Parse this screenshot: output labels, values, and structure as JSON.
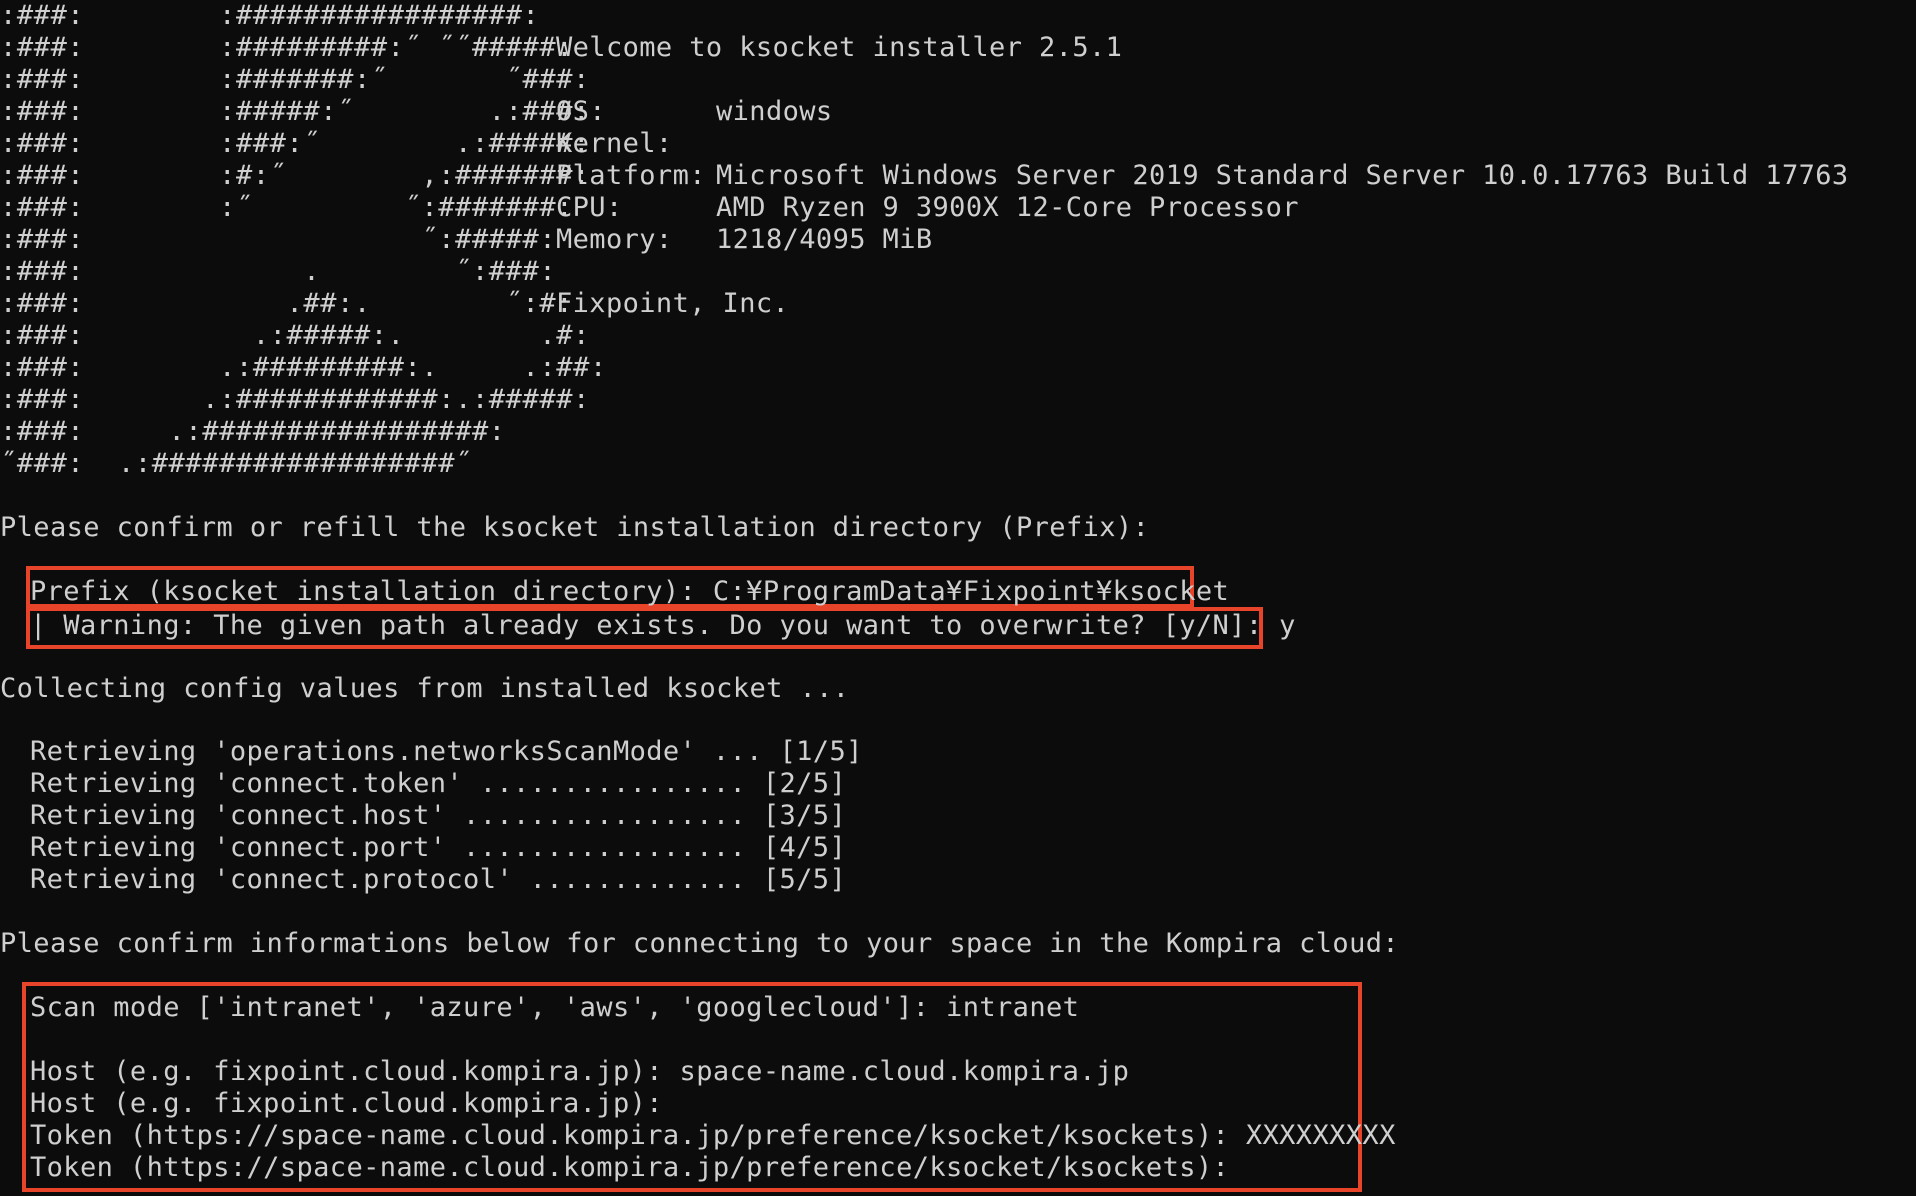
{
  "art": [
    ":###:        :#################:",
    ":###:        :#########:˝ ˝˝#####:",
    ":###:        :#######:˝       ˝###:",
    ":###:        :#####:˝        .:###:",
    ":###:        :###:˝        .:#####:",
    ":###:        :#:˝        ,:#######:",
    ":###:        :˝         ˝:#######:",
    ":###:                    ˝:#####:",
    ":###:             .        ˝:###:",
    ":###:            .##:.        ˝:#:",
    ":###:          .:#####:.        .#:",
    ":###:        .:#########:.     .:##:",
    ":###:       .:############:.:#####:",
    ":###:     .:#################:",
    "˝###:  .:##################˝"
  ],
  "info": {
    "welcome": "Welcome to ksocket installer 2.5.1",
    "os_label": "OS:",
    "os_value": "windows",
    "kernel_label": "Kernel:",
    "kernel_value": "",
    "platform_label": "Platform:",
    "platform_value": "Microsoft Windows Server 2019 Standard Server 10.0.17763 Build 17763",
    "cpu_label": "CPU:",
    "cpu_value": "AMD Ryzen 9 3900X 12-Core Processor",
    "memory_label": "Memory:",
    "memory_value": "1218/4095 MiB",
    "company": "Fixpoint, Inc."
  },
  "prefix_prompt": "Please confirm or refill the ksocket installation directory (Prefix):",
  "prefix_line": "Prefix (ksocket installation directory): C:¥ProgramData¥Fixpoint¥ksocket",
  "warning_line": "| Warning: The given path already exists. Do you want to overwrite? [y/N]: y",
  "collecting": "Collecting config values from installed ksocket ...",
  "retrieving": [
    "Retrieving 'operations.networksScanMode' ... [1/5]",
    "Retrieving 'connect.token' ................ [2/5]",
    "Retrieving 'connect.host' ................. [3/5]",
    "Retrieving 'connect.port' ................. [4/5]",
    "Retrieving 'connect.protocol' ............. [5/5]"
  ],
  "confirm_prompt": "Please confirm informations below for connecting to your space in the Kompira cloud:",
  "scan_mode": "Scan mode ['intranet', 'azure', 'aws', 'googlecloud']: intranet",
  "host_line_1": "Host (e.g. fixpoint.cloud.kompira.jp): space-name.cloud.kompira.jp",
  "host_line_2": "Host (e.g. fixpoint.cloud.kompira.jp):",
  "token_line_1": "Token (https://space-name.cloud.kompira.jp/preference/ksocket/ksockets): XXXXXXXXX",
  "token_line_2": "Token (https://space-name.cloud.kompira.jp/preference/ksocket/ksockets):"
}
